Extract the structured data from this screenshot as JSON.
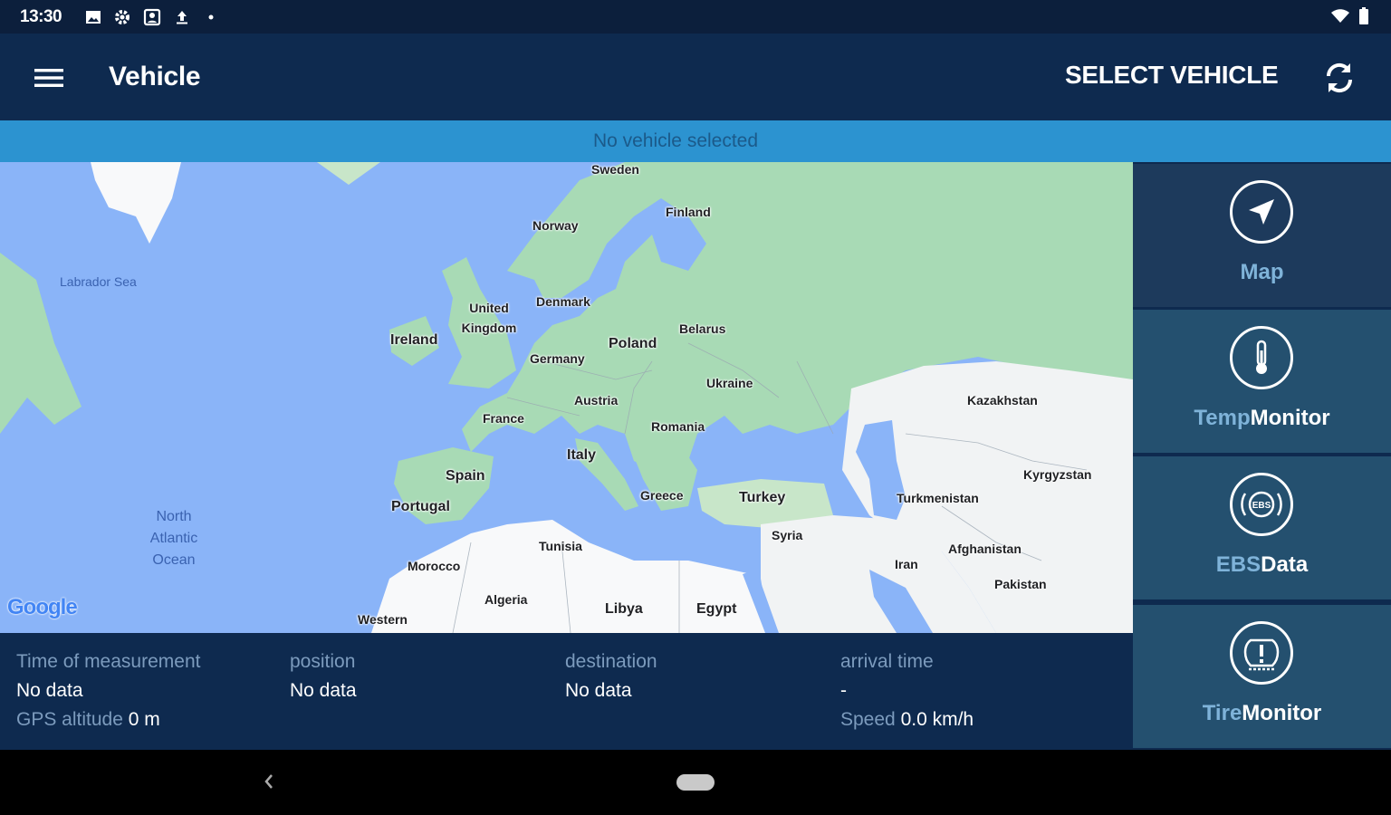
{
  "status_bar": {
    "time": "13:30",
    "left_icons": [
      "image-icon",
      "settings-icon",
      "account-box-icon",
      "upload-icon",
      "dot-icon"
    ],
    "right_icons": [
      "wifi-icon",
      "battery-icon"
    ]
  },
  "app_bar": {
    "title": "Vehicle",
    "select_vehicle_label": "SELECT VEHICLE",
    "menu_icon": "menu-icon",
    "refresh_icon": "refresh-icon"
  },
  "status_strip": {
    "message": "No vehicle selected"
  },
  "map": {
    "labels": [
      {
        "text": "Sweden",
        "type": "country"
      },
      {
        "text": "Finland",
        "type": "country"
      },
      {
        "text": "Norway",
        "type": "country"
      },
      {
        "text": "Labrador Sea",
        "type": "water"
      },
      {
        "text": "United Kingdom",
        "type": "country"
      },
      {
        "text": "Denmark",
        "type": "country"
      },
      {
        "text": "Ireland",
        "type": "country"
      },
      {
        "text": "Belarus",
        "type": "country"
      },
      {
        "text": "Poland",
        "type": "country"
      },
      {
        "text": "Germany",
        "type": "country"
      },
      {
        "text": "Ukraine",
        "type": "country"
      },
      {
        "text": "Kazakhstan",
        "type": "country"
      },
      {
        "text": "Austria",
        "type": "country"
      },
      {
        "text": "France",
        "type": "country"
      },
      {
        "text": "Romania",
        "type": "country"
      },
      {
        "text": "Italy",
        "type": "country"
      },
      {
        "text": "Kyrgyzstan",
        "type": "country"
      },
      {
        "text": "Spain",
        "type": "country"
      },
      {
        "text": "Greece",
        "type": "country"
      },
      {
        "text": "Turkey",
        "type": "country"
      },
      {
        "text": "Turkmenistan",
        "type": "country"
      },
      {
        "text": "Portugal",
        "type": "country"
      },
      {
        "text": "North Atlantic Ocean",
        "type": "water"
      },
      {
        "text": "Syria",
        "type": "country"
      },
      {
        "text": "Tunisia",
        "type": "country"
      },
      {
        "text": "Afghanistan",
        "type": "country"
      },
      {
        "text": "Iran",
        "type": "country"
      },
      {
        "text": "Morocco",
        "type": "country"
      },
      {
        "text": "Pakistan",
        "type": "country"
      },
      {
        "text": "Algeria",
        "type": "country"
      },
      {
        "text": "Libya",
        "type": "country"
      },
      {
        "text": "Egypt",
        "type": "country"
      },
      {
        "text": "Western",
        "type": "country"
      }
    ],
    "attribution": "Google",
    "colors": {
      "water": "#8ab4f8",
      "land": "#a8dab5",
      "desert": "#f1f3f4"
    }
  },
  "info_panel": {
    "columns": [
      {
        "label": "Time of measurement",
        "value": "No data",
        "extra_label": "GPS altitude",
        "extra_value": "0 m"
      },
      {
        "label": "position",
        "value": "No data"
      },
      {
        "label": "destination",
        "value": "No data"
      },
      {
        "label": "arrival time",
        "value": "-",
        "extra_label": "Speed",
        "extra_value": "0.0 km/h"
      }
    ]
  },
  "side_nav": {
    "items": [
      {
        "prefix": "",
        "label": "Map",
        "icon": "navigation-arrow-icon",
        "active": true
      },
      {
        "prefix": "Temp",
        "label": "Monitor",
        "icon": "thermometer-icon",
        "active": false
      },
      {
        "prefix": "EBS",
        "label": "Data",
        "icon": "ebs-brake-icon",
        "icon_text": "EBS",
        "active": false
      },
      {
        "prefix": "Tire",
        "label": "Monitor",
        "icon": "tire-pressure-icon",
        "active": false
      }
    ]
  },
  "colors": {
    "app_bar": "#0e2a4f",
    "status_bar": "#0c1f3c",
    "strip": "#2c93d0",
    "nav_item": "#24506f",
    "nav_item_active": "#1d3a5c",
    "accent_text": "#7fb3d9"
  }
}
